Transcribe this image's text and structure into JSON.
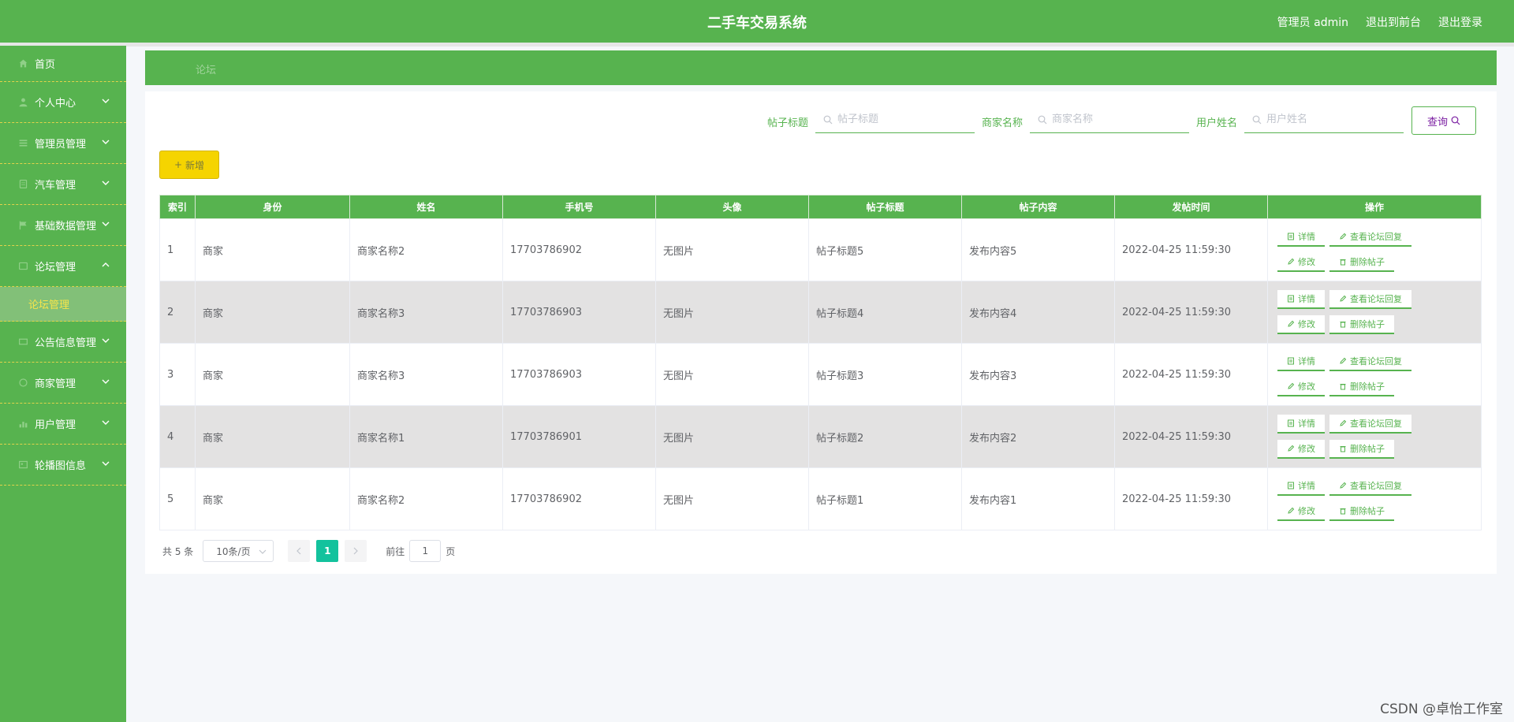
{
  "header": {
    "title": "二手车交易系统",
    "admin_label": "管理员 admin",
    "front_label": "退出到前台",
    "logout_label": "退出登录"
  },
  "sidebar": {
    "items": [
      {
        "label": "首页",
        "icon": "home-icon"
      },
      {
        "label": "个人中心",
        "icon": "user-icon"
      },
      {
        "label": "管理员管理",
        "icon": "list-icon"
      },
      {
        "label": "汽车管理",
        "icon": "car-icon"
      },
      {
        "label": "基础数据管理",
        "icon": "flag-icon"
      },
      {
        "label": "论坛管理",
        "icon": "forum-icon"
      },
      {
        "label": "公告信息管理",
        "icon": "notice-icon"
      },
      {
        "label": "商家管理",
        "icon": "shop-icon"
      },
      {
        "label": "用户管理",
        "icon": "chart-icon"
      },
      {
        "label": "轮播图信息",
        "icon": "image-icon"
      }
    ],
    "active_sub": "论坛管理"
  },
  "breadcrumb": "论坛",
  "search": {
    "post_title_label": "帖子标题",
    "post_title_placeholder": "帖子标题",
    "merchant_label": "商家名称",
    "merchant_placeholder": "商家名称",
    "user_label": "用户姓名",
    "user_placeholder": "用户姓名",
    "query_label": "查询"
  },
  "add_label": "新增",
  "table": {
    "headers": [
      "索引",
      "身份",
      "姓名",
      "手机号",
      "头像",
      "帖子标题",
      "帖子内容",
      "发帖时间",
      "操作"
    ],
    "rows": [
      [
        "1",
        "商家",
        "商家名称2",
        "17703786902",
        "无图片",
        "帖子标题5",
        "发布内容5",
        "2022-04-25 11:59:30"
      ],
      [
        "2",
        "商家",
        "商家名称3",
        "17703786903",
        "无图片",
        "帖子标题4",
        "发布内容4",
        "2022-04-25 11:59:30"
      ],
      [
        "3",
        "商家",
        "商家名称3",
        "17703786903",
        "无图片",
        "帖子标题3",
        "发布内容3",
        "2022-04-25 11:59:30"
      ],
      [
        "4",
        "商家",
        "商家名称1",
        "17703786901",
        "无图片",
        "帖子标题2",
        "发布内容2",
        "2022-04-25 11:59:30"
      ],
      [
        "5",
        "商家",
        "商家名称2",
        "17703786902",
        "无图片",
        "帖子标题1",
        "发布内容1",
        "2022-04-25 11:59:30"
      ]
    ],
    "ops": {
      "detail": "详情",
      "view_reply": "查看论坛回复",
      "edit": "修改",
      "delete": "删除帖子"
    }
  },
  "pager": {
    "total": "共 5 条",
    "page_size": "10条/页",
    "current": "1",
    "goto_prefix": "前往",
    "goto_value": "1",
    "goto_suffix": "页"
  },
  "watermark": "CSDN @卓怡工作室",
  "colors": {
    "primary": "#57b34f",
    "accent_yellow": "#f5d400",
    "pager_active": "#13c29d",
    "row_stripe": "#e3e2e2"
  }
}
